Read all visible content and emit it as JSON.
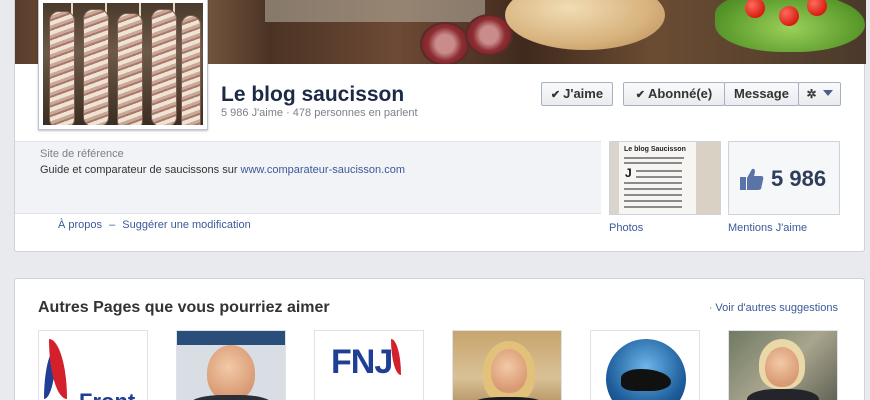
{
  "page": {
    "name": "Le blog saucisson",
    "stats": "5 986 J'aime · 478 personnes en parlent"
  },
  "actions": {
    "like_label": "J'aime",
    "follow_label": "Abonné(e)",
    "message_label": "Message",
    "check_glyph": "✔",
    "gear_glyph": "✲"
  },
  "about": {
    "label": "Site de référence",
    "text_prefix": "Guide et comparateur de saucissons sur ",
    "link": "www.comparateur-saucisson.com",
    "about_link": "À propos",
    "separator": "–",
    "suggest_link": "Suggérer une modification"
  },
  "tiles": {
    "photos_caption": "Photos",
    "photos_doc_title": "Le blog Saucisson",
    "photos_doc_letter": "J",
    "likes_count": "5 986",
    "likes_caption": "Mentions J'aime"
  },
  "suggestions": {
    "title": "Autres Pages que vous pourriez aimer",
    "more_link": "Voir d'autres suggestions",
    "bullet": "·",
    "fn_text": "Front",
    "fnj_text": "FNJ"
  },
  "colors": {
    "link": "#3b5998",
    "name": "#1d2a47",
    "background": "#e9eaed"
  }
}
